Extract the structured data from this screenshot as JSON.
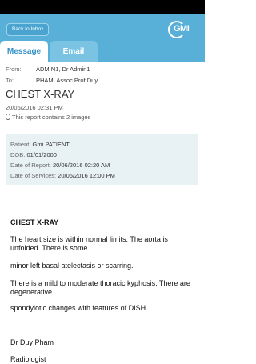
{
  "header": {
    "back_label": "Back to Inbox",
    "logo_text": "GMI"
  },
  "tabs": [
    {
      "label": "Message",
      "active": true
    },
    {
      "label": "Email",
      "active": false
    }
  ],
  "message": {
    "from_label": "From:",
    "from_value": "ADMIN1, Dr Admin1",
    "to_label": "To:",
    "to_value": "PHAM, Assoc Prof Duy",
    "title": "CHEST X-RAY",
    "datetime": "20/06/2016 02:31 PM",
    "attachment_text": "This report contains 2 images"
  },
  "patient": {
    "patient_label": "Patient:",
    "patient_value": "Gmi PATIENT",
    "dob_label": "DOB:",
    "dob_value": "01/01/2000",
    "report_date_label": "Date of Report:",
    "report_date_value": "20/06/2016 02:20 AM",
    "services_date_label": "Date of Services:",
    "services_date_value": "20/06/2016 12:00 PM"
  },
  "report": {
    "heading": "CHEST X-RAY",
    "line1": "The heart size is within normal limits. The aorta is unfolded. There is some",
    "line2": "minor left basal atelectasis or scarring.",
    "line3": "There is a mild to moderate thoracic kyphosis. There are degenerative",
    "line4": "spondylotic changes with features of DISH.",
    "signature_name": "Dr Duy Pham",
    "signature_title": "Radiologist"
  },
  "colors": {
    "header": "#58b0d8",
    "tab_active_text": "#2f8fc4",
    "tab_inactive_bg": "#7bc3e3",
    "infobox_bg": "#e8f1f4"
  }
}
